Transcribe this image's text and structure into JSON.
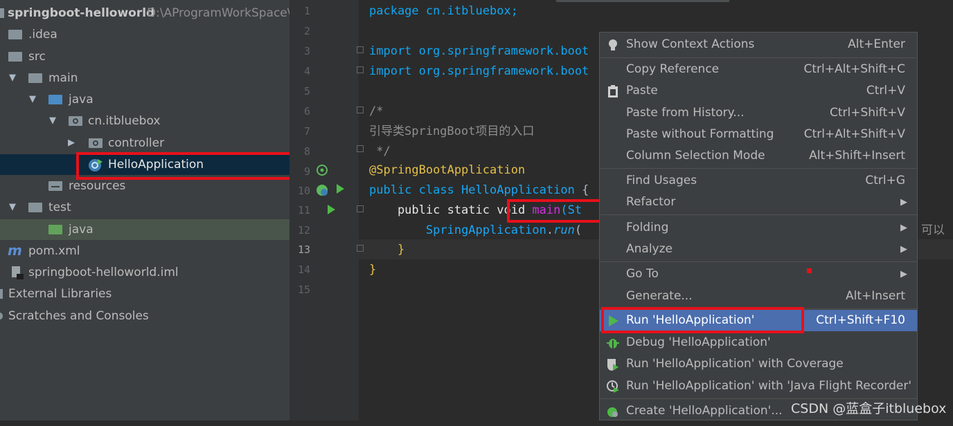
{
  "project_tree": {
    "items": [
      {
        "label": "springboot-helloworld",
        "path": "D:\\AProgramWorkSpace\\i"
      },
      {
        "label": ".idea"
      },
      {
        "label": "src"
      },
      {
        "label": "main"
      },
      {
        "label": "java"
      },
      {
        "label": "cn.itbluebox"
      },
      {
        "label": "controller"
      },
      {
        "label": "HelloApplication"
      },
      {
        "label": "resources"
      },
      {
        "label": "test"
      },
      {
        "label": "java"
      },
      {
        "label": "pom.xml"
      },
      {
        "label": "springboot-helloworld.iml"
      },
      {
        "label": "External Libraries"
      },
      {
        "label": "Scratches and Consoles"
      }
    ]
  },
  "editor": {
    "line_numbers": [
      "1",
      "2",
      "3",
      "4",
      "5",
      "6",
      "7",
      "8",
      "9",
      "10",
      "11",
      "12",
      "13",
      "14",
      "15"
    ],
    "current_line": "13",
    "code": {
      "l1_kw": "package ",
      "l1_rest": "cn.itbluebox;",
      "l3_kw": "import ",
      "l3_rest": "org.springframework.boot",
      "l4_kw": "import ",
      "l4_rest": "org.springframework.boot",
      "l6": "/*",
      "l7": "引导类SpringBoot项目的入口",
      "l8": " */",
      "l9": "@SpringBootApplication",
      "l10_kw": "public class ",
      "l10_cls": "HelloApplication",
      "l10_rest": " {",
      "l11_kw1": "    public static ",
      "l11_kw2": "void ",
      "l11_method": "main",
      "l11_rest": "(St",
      "l12_indent": "        ",
      "l12_cls": "SpringApplication",
      "l12_dot": ".",
      "l12_call": "run",
      "l12_rest": "(",
      "l12_tail": "可以",
      "l13": "    }",
      "l14": "}"
    }
  },
  "context_menu": {
    "items": [
      {
        "label": "Show Context Actions",
        "shortcut": "Alt+Enter",
        "icon": "bulb-icon"
      },
      {
        "label": "Copy Reference",
        "shortcut": "Ctrl+Alt+Shift+C"
      },
      {
        "label": "Paste",
        "shortcut": "Ctrl+V",
        "icon": "clipboard-icon"
      },
      {
        "label": "Paste from History...",
        "shortcut": "Ctrl+Shift+V"
      },
      {
        "label": "Paste without Formatting",
        "shortcut": "Ctrl+Alt+Shift+V"
      },
      {
        "label": "Column Selection Mode",
        "shortcut": "Alt+Shift+Insert"
      },
      {
        "label": "Find Usages",
        "shortcut": "Ctrl+G"
      },
      {
        "label": "Refactor",
        "submenu": "▶"
      },
      {
        "label": "Folding",
        "submenu": "▶"
      },
      {
        "label": "Analyze",
        "submenu": "▶"
      },
      {
        "label": "Go To",
        "submenu": "▶"
      },
      {
        "label": "Generate...",
        "shortcut": "Alt+Insert"
      },
      {
        "label": "Run 'HelloApplication'",
        "shortcut": "Ctrl+Shift+F10",
        "icon": "run-icon"
      },
      {
        "label": "Debug 'HelloApplication'",
        "icon": "debug-icon"
      },
      {
        "label": "Run 'HelloApplication' with Coverage",
        "icon": "coverage-icon"
      },
      {
        "label": "Run 'HelloApplication' with 'Java Flight Recorder'",
        "icon": "profiler-icon"
      },
      {
        "label": "Create 'HelloApplication'...",
        "icon": "create-config-icon"
      }
    ]
  },
  "watermark": "CSDN @蓝盒子itbluebox",
  "colors": {
    "highlight_box": "#e8101a",
    "menu_selection": "#4b6eaf",
    "keyword": "#0fa7f2",
    "annotation": "#e4c047"
  }
}
